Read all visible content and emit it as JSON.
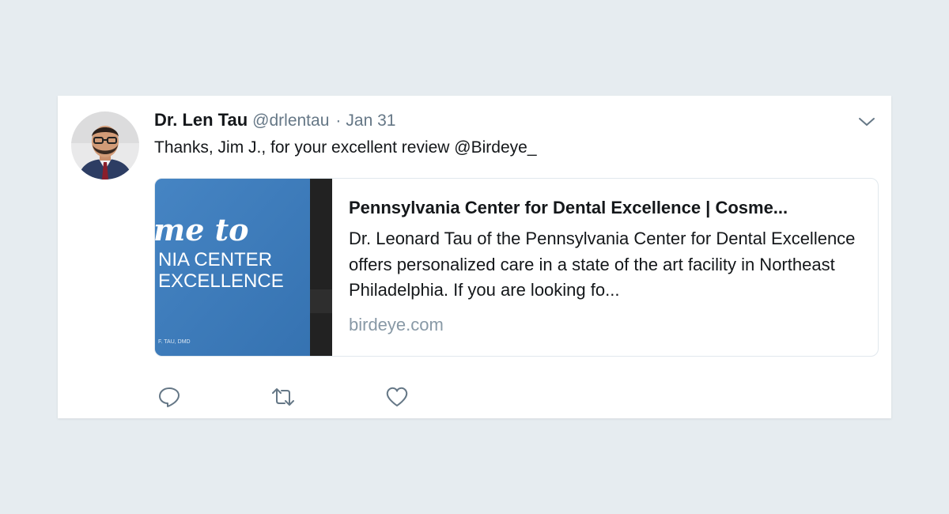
{
  "tweet": {
    "author": {
      "display_name": "Dr. Len Tau",
      "handle": "@drlentau",
      "avatar_icon": "profile-photo"
    },
    "separator": "·",
    "timestamp": "Jan 31",
    "text_prefix": "Thanks, Jim J., for your excellent review ",
    "mention": "@Birdeye_",
    "menu_icon": "chevron-down-icon",
    "link_card": {
      "image_text": {
        "line1": "me to",
        "line2": "NIA CENTER",
        "line3": "EXCELLENCE",
        "small": "F. TAU, DMD"
      },
      "title": "Pennsylvania Center for Dental Excellence | Cosme...",
      "description": "Dr. Leonard Tau of the Pennsylvania Center for Dental Excellence offers personalized care in a state of the art facility in Northeast Philadelphia. If you are looking fo...",
      "domain": "birdeye.com"
    },
    "actions": [
      {
        "name": "reply",
        "icon": "reply-icon"
      },
      {
        "name": "retweet",
        "icon": "retweet-icon"
      },
      {
        "name": "like",
        "icon": "heart-icon"
      }
    ]
  },
  "colors": {
    "background": "#e6ecf0",
    "card": "#ffffff",
    "text_primary": "#14171a",
    "text_secondary": "#657786",
    "domain": "#8899a6",
    "card_image_blue": "#3f7fbf",
    "card_image_dark": "#222222"
  }
}
